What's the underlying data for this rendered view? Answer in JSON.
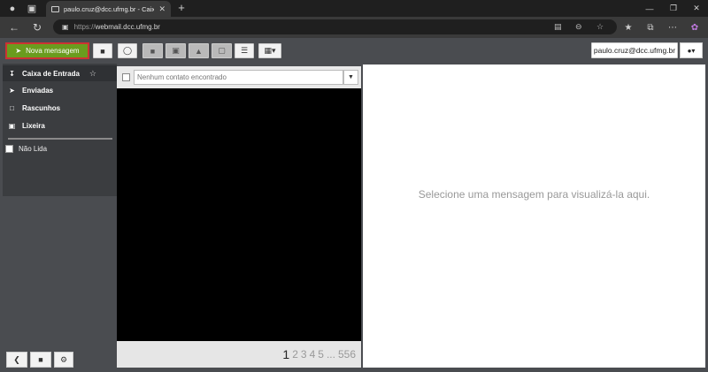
{
  "browser": {
    "tab_title": "paulo.cruz@dcc.ufmg.br - Caixa de Entrada",
    "url_scheme": "https://",
    "url_host": "webmail.dcc.ufmg.br"
  },
  "toolbar": {
    "compose_label": "Nova mensagem",
    "user_email": "paulo.cruz@dcc.ufmg.br",
    "accent_color": "#6a9c1e"
  },
  "sidebar": {
    "folders": [
      {
        "label": "Caixa de Entrada",
        "icon": "inbox-icon"
      },
      {
        "label": "Enviadas",
        "icon": "send-icon"
      },
      {
        "label": "Rascunhos",
        "icon": "draft-icon"
      },
      {
        "label": "Lixeira",
        "icon": "trash-icon"
      }
    ],
    "unread_label": "Não Lida"
  },
  "list": {
    "search_placeholder": "Nenhum contato encontrado",
    "pages": [
      "1",
      "2",
      "3",
      "4",
      "5",
      "...",
      "556"
    ]
  },
  "preview": {
    "empty_message": "Selecione uma mensagem para visualizá-la aqui."
  }
}
